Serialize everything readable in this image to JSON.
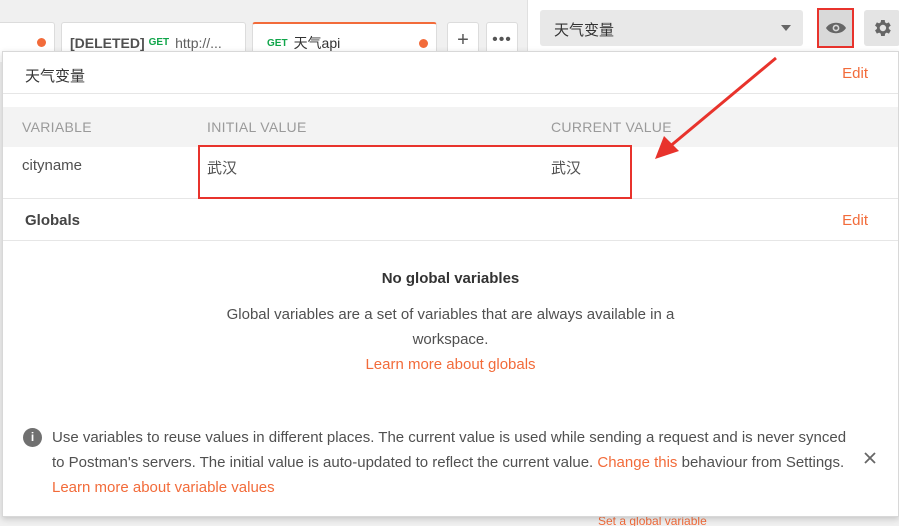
{
  "tabs": [
    {
      "label": ""
    },
    {
      "title": "[DELETED]",
      "method": "GET",
      "url": "http://..."
    },
    {
      "method": "GET",
      "title": "天气api"
    }
  ],
  "tab_actions": {
    "add": "+",
    "more": "•••"
  },
  "environment": {
    "selected": "天气变量"
  },
  "env_section": {
    "title": "天气变量",
    "edit": "Edit",
    "columns": [
      "VARIABLE",
      "INITIAL VALUE",
      "CURRENT VALUE"
    ],
    "rows": [
      {
        "variable": "cityname",
        "initial": "武汉",
        "current": "武汉"
      }
    ]
  },
  "globals": {
    "title": "Globals",
    "edit": "Edit",
    "empty_title": "No global variables",
    "empty_desc": "Global variables are a set of variables that are always available in a workspace.",
    "learn_link": "Learn more about globals"
  },
  "info": {
    "text1": "Use variables to reuse values in different places. The current value is used while sending a request and is never synced to Postman's servers. The initial value is auto-updated to reflect the current value. ",
    "link1": "Change this",
    "text2": " behaviour from Settings. ",
    "link2": "Learn more about variable values"
  },
  "background_peek": "Set a global variable",
  "icons": {
    "eye": "eye-icon",
    "gear": "gear-icon",
    "close": "close-icon",
    "info": "info-icon",
    "caret": "chevron-down-icon"
  },
  "colors": {
    "accent": "#f26b3a",
    "highlight": "#e8332c",
    "method_get": "#10a54a"
  }
}
